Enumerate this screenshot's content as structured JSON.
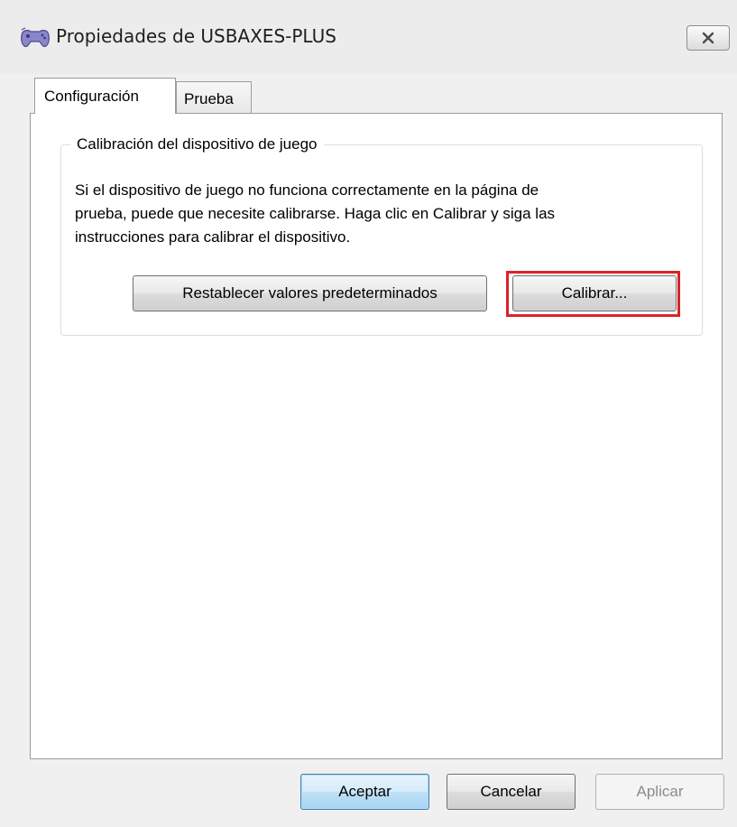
{
  "window": {
    "title": "Propiedades de USBAXES-PLUS",
    "icon": "gamepad-icon",
    "close_icon": "close-icon"
  },
  "tabs": [
    {
      "label": "Configuración",
      "active": true
    },
    {
      "label": "Prueba",
      "active": false
    }
  ],
  "calibration": {
    "group_title": "Calibración del dispositivo de juego",
    "description_lines": [
      "Si el dispositivo de juego no funciona correctamente en la página de",
      "prueba, puede que necesite calibrarse.  Haga clic en Calibrar y siga las",
      "instrucciones para calibrar el dispositivo."
    ],
    "restore_label": "Restablecer valores predeterminados",
    "calibrate_label": "Calibrar...",
    "highlight_color": "#d9232a"
  },
  "footer": {
    "ok_label": "Aceptar",
    "cancel_label": "Cancelar",
    "apply_label": "Aplicar"
  }
}
